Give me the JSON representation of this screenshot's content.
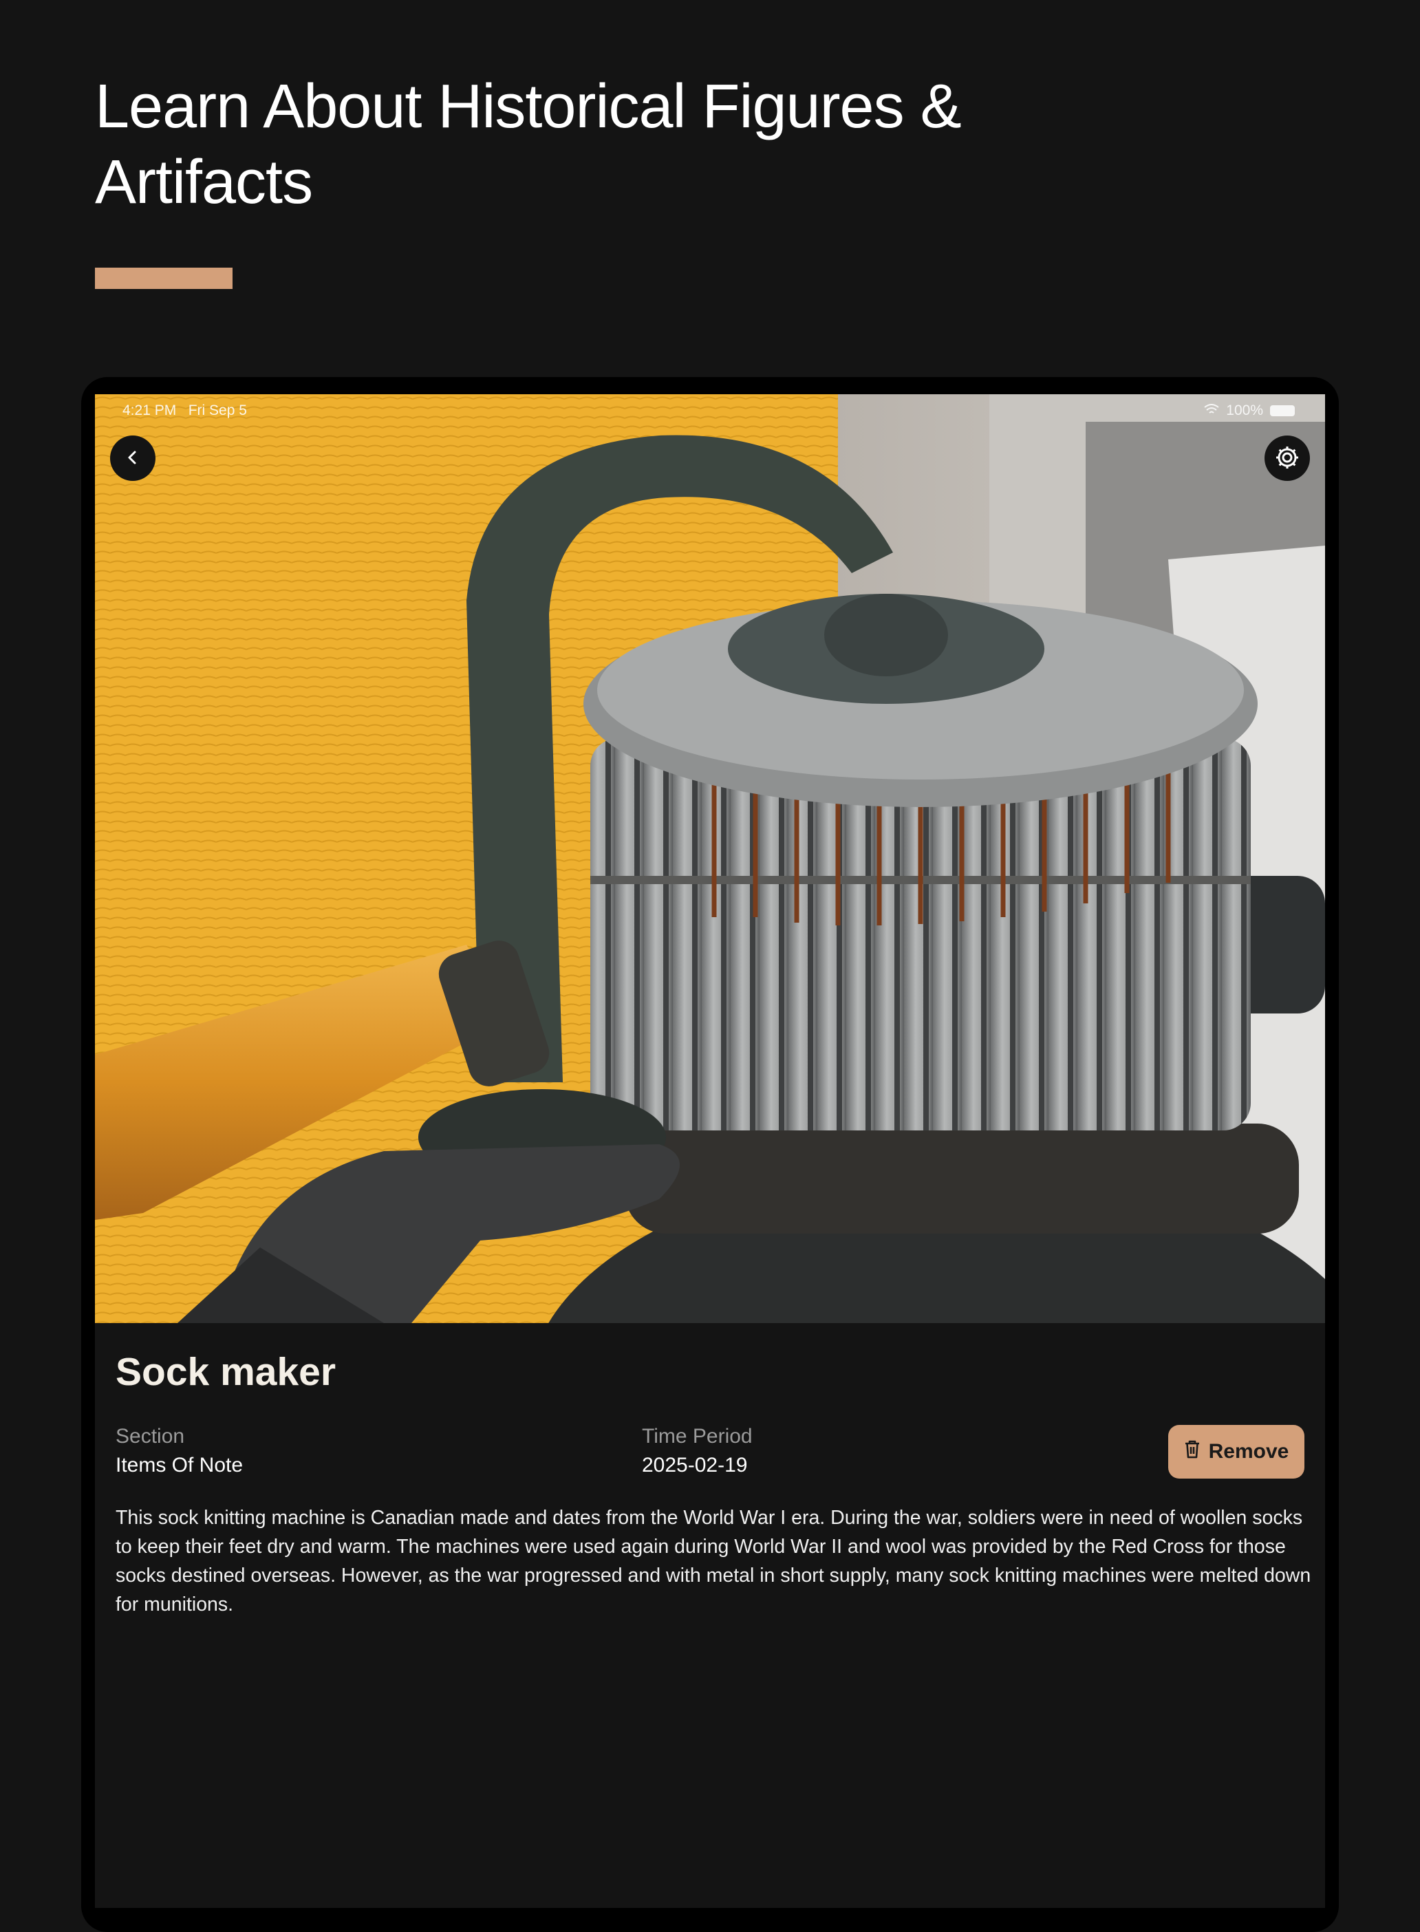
{
  "promo": {
    "title_line1": "Learn About Historical Figures &",
    "title_line2": "Artifacts",
    "accent_color": "#d4a07a"
  },
  "status_bar": {
    "time": "4:21 PM",
    "date": "Fri Sep 5",
    "battery": "100%"
  },
  "hero_image": {
    "subject": "hand-cranked sock knitting machine"
  },
  "icons": {
    "back": "chevron-left-icon",
    "settings": "gear-icon",
    "remove": "trash-icon"
  },
  "artifact": {
    "title": "Sock maker",
    "section_label": "Section",
    "section_value": "Items Of Note",
    "period_label": "Time Period",
    "period_value": "2025-02-19",
    "remove_label": "Remove",
    "description": "This sock knitting machine is Canadian made and dates from the World War I era.  During the war, soldiers were in need of woollen socks to keep their feet dry and warm. The machines were used again during World War II and wool was provided by the Red Cross for those socks destined overseas.  However, as the war progressed and with metal in short supply, many sock knitting machines were melted down for munitions."
  },
  "colors": {
    "background": "#141414",
    "button": "#d4a07a"
  }
}
